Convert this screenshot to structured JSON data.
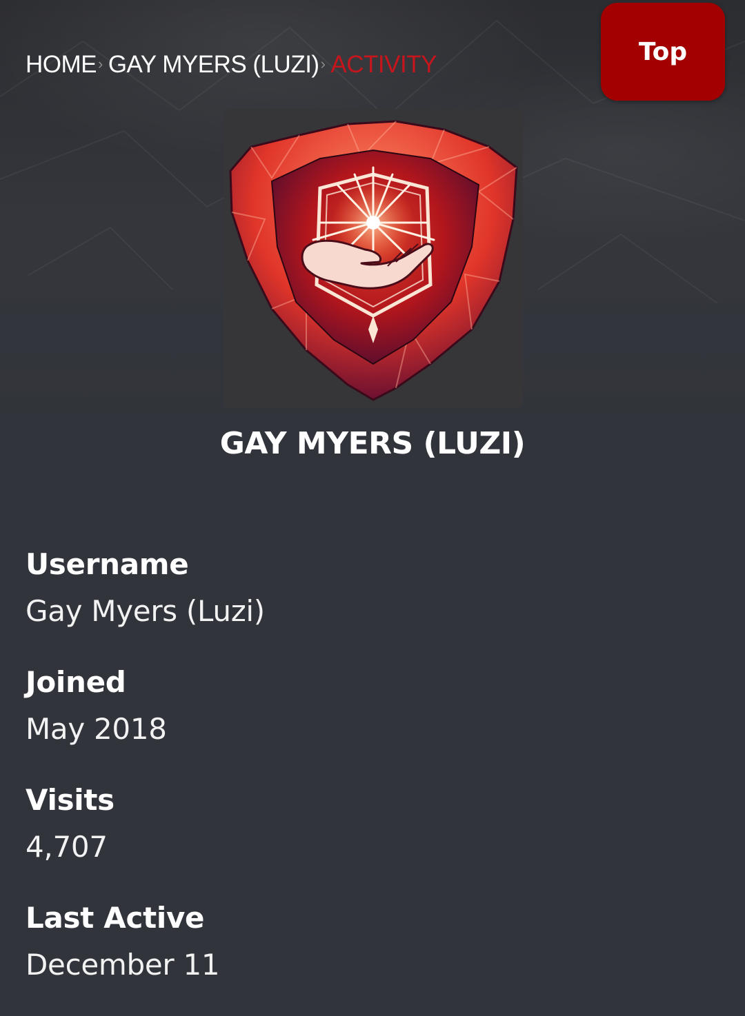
{
  "breadcrumb": {
    "items": [
      {
        "label": "HOME"
      },
      {
        "label": "GAY MYERS (LUZI)"
      },
      {
        "label": "ACTIVITY"
      }
    ],
    "separator": "›"
  },
  "top_button": {
    "label": "Top"
  },
  "profile": {
    "name": "GAY MYERS (LUZI)",
    "avatar_icon": "crystal-shield-hand-emblem-icon"
  },
  "info": {
    "username": {
      "label": "Username",
      "value": "Gay Myers (Luzi)"
    },
    "joined": {
      "label": "Joined",
      "value": "May 2018"
    },
    "visits": {
      "label": "Visits",
      "value": "4,707"
    },
    "last_active": {
      "label": "Last Active",
      "value": "December 11"
    }
  },
  "colors": {
    "background": "#32343b",
    "accent": "#a30001",
    "breadcrumb_current": "#c4161c"
  }
}
